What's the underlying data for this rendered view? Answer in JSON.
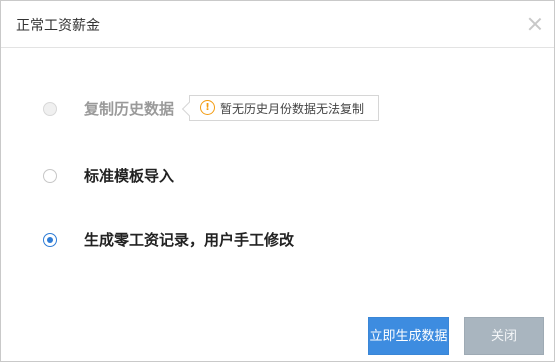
{
  "dialog": {
    "title": "正常工资薪金",
    "close_icon": "close-x-icon"
  },
  "options": [
    {
      "label": "复制历史数据",
      "state": "disabled"
    },
    {
      "label": "标准模板导入",
      "state": "unchecked"
    },
    {
      "label": "生成零工资记录，用户手工修改",
      "state": "checked"
    }
  ],
  "tip": {
    "icon": "warning-circle-icon",
    "icon_glyph": "!",
    "text": "暂无历史月份数据无法复制"
  },
  "buttons": {
    "primary": "立即生成数据",
    "close": "关闭"
  },
  "colors": {
    "accent": "#3d8ce0",
    "warning": "#f39c12",
    "disabled_button": "#a9b5bf"
  }
}
